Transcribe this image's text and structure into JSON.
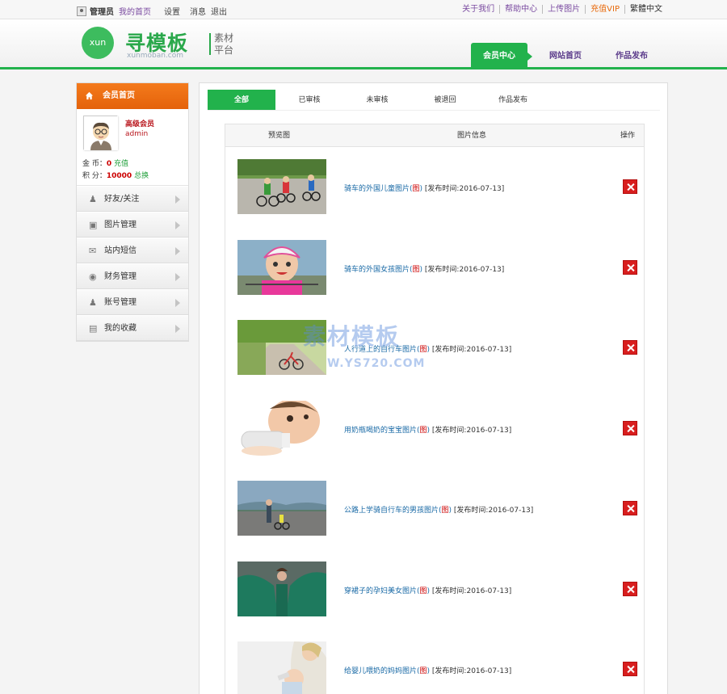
{
  "topbar": {
    "user": "管理员",
    "home": "我的首页",
    "settings": "设置",
    "messages": "消息",
    "logout": "退出",
    "links": [
      "关于我们",
      "帮助中心",
      "上传图片",
      "充值VIP",
      "繁體中文"
    ]
  },
  "header": {
    "logo_circle": "xun",
    "logo_text": "寻模板",
    "logo_sub": "xunmoban.com",
    "tag_line1": "素材",
    "tag_line2": "平台",
    "nav": [
      "会员中心",
      "网站首页",
      "作品发布"
    ]
  },
  "sidebar": {
    "title": "会员首页",
    "level": "高级会员",
    "username": "admin",
    "coin_label": "金 币：",
    "coin_value": "0",
    "coin_action": "充值",
    "points_label": "积 分：",
    "points_value": "10000",
    "points_action": "总换",
    "items": [
      {
        "label": "好友/关注",
        "icon": "user-add-icon"
      },
      {
        "label": "图片管理",
        "icon": "image-icon"
      },
      {
        "label": "站内短信",
        "icon": "mail-icon"
      },
      {
        "label": "财务管理",
        "icon": "moneybag-icon"
      },
      {
        "label": "账号管理",
        "icon": "user-settings-icon"
      },
      {
        "label": "我的收藏",
        "icon": "folder-icon"
      }
    ]
  },
  "tabs": [
    "全部",
    "已审核",
    "未审核",
    "被退回",
    "作品发布"
  ],
  "table": {
    "col_preview": "预览图",
    "col_info": "图片信息",
    "col_action": "操作",
    "rows": [
      {
        "title": "骑车的外国儿童图片",
        "tag": "图",
        "time": "[发布时间:2016-07-13]"
      },
      {
        "title": "骑车的外国女孩图片",
        "tag": "图",
        "time": "[发布时间:2016-07-13]"
      },
      {
        "title": "人行道上的自行车图片",
        "tag": "图",
        "time": "[发布时间:2016-07-13]"
      },
      {
        "title": "用奶瓶喝奶的宝宝图片",
        "tag": "图",
        "time": "[发布时间:2016-07-13]"
      },
      {
        "title": "公路上学骑自行车的男孩图片",
        "tag": "图",
        "time": "[发布时间:2016-07-13]"
      },
      {
        "title": "穿裙子的孕妇美女图片",
        "tag": "图",
        "time": "[发布时间:2016-07-13]"
      },
      {
        "title": "给婴儿喂奶的妈妈图片",
        "tag": "图",
        "time": "[发布时间:2016-07-13]"
      }
    ]
  },
  "watermark": {
    "line1": "素材模板",
    "line2": "W.YS720.COM"
  },
  "colors": {
    "accent": "#22b24c",
    "orange": "#e4620a",
    "danger": "#d81e1e",
    "link": "#1a6aa6"
  }
}
